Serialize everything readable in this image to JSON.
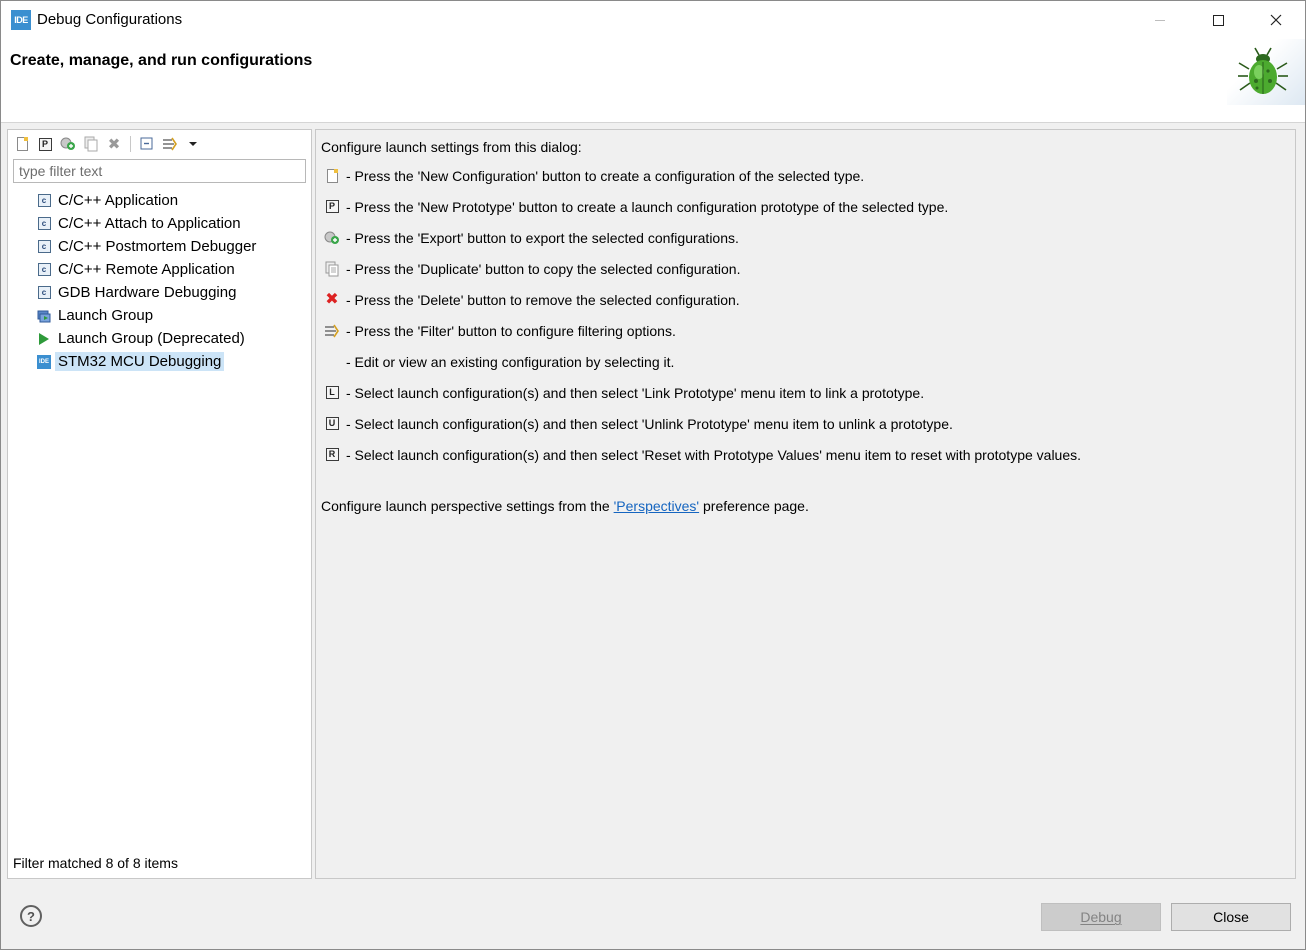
{
  "window": {
    "app_icon_text": "IDE",
    "title": "Debug Configurations"
  },
  "banner": {
    "title": "Create, manage, and run configurations",
    "icon": "bug-icon"
  },
  "left": {
    "toolbar": [
      {
        "name": "new-configuration-button",
        "icon": "new-page-icon"
      },
      {
        "name": "new-prototype-button",
        "icon": "new-prototype-icon"
      },
      {
        "name": "export-button",
        "icon": "export-icon"
      },
      {
        "name": "duplicate-button",
        "icon": "duplicate-icon"
      },
      {
        "name": "delete-button",
        "icon": "delete-icon"
      },
      {
        "name": "collapse-all-button",
        "icon": "collapse-icon"
      },
      {
        "name": "filter-button",
        "icon": "filter-icon"
      },
      {
        "name": "filter-menu-button",
        "icon": "chevron-down-icon"
      }
    ],
    "filter_placeholder": "type filter text",
    "tree": [
      {
        "label": "C/C++ Application",
        "icon": "c-app-icon"
      },
      {
        "label": "C/C++ Attach to Application",
        "icon": "c-app-icon"
      },
      {
        "label": "C/C++ Postmortem Debugger",
        "icon": "c-app-icon"
      },
      {
        "label": "C/C++ Remote Application",
        "icon": "c-app-icon"
      },
      {
        "label": "GDB Hardware Debugging",
        "icon": "c-app-icon"
      },
      {
        "label": "Launch Group",
        "icon": "launch-group-icon"
      },
      {
        "label": "Launch Group (Deprecated)",
        "icon": "play-icon"
      },
      {
        "label": "STM32 MCU Debugging",
        "icon": "ide-icon",
        "selected": true
      }
    ],
    "filter_status": "Filter matched 8 of 8 items"
  },
  "right": {
    "intro": "Configure launch settings from this dialog:",
    "instructions": [
      {
        "icon": "new-page-icon",
        "text": "- Press the 'New Configuration' button to create a configuration of the selected type."
      },
      {
        "icon": "new-prototype-icon",
        "text": "- Press the 'New Prototype' button to create a launch configuration prototype of the selected type."
      },
      {
        "icon": "export-icon",
        "text": "- Press the 'Export' button to export the selected configurations."
      },
      {
        "icon": "duplicate-icon",
        "text": "- Press the 'Duplicate' button to copy the selected configuration."
      },
      {
        "icon": "delete-icon",
        "text": "- Press the 'Delete' button to remove the selected configuration."
      },
      {
        "icon": "filter-icon",
        "text": "- Press the 'Filter' button to configure filtering options."
      },
      {
        "icon": "",
        "text": "- Edit or view an existing configuration by selecting it."
      },
      {
        "icon": "link-prototype-icon",
        "icon_letter": "L",
        "text": "- Select launch configuration(s) and then select 'Link Prototype' menu item to link a prototype."
      },
      {
        "icon": "unlink-prototype-icon",
        "icon_letter": "U",
        "text": "- Select launch configuration(s) and then select 'Unlink Prototype' menu item to unlink a prototype."
      },
      {
        "icon": "reset-prototype-icon",
        "icon_letter": "R",
        "text": "- Select launch configuration(s) and then select 'Reset with Prototype Values' menu item to reset with prototype values."
      }
    ],
    "perspective_before": "Configure launch perspective settings from the ",
    "perspective_link": "'Perspectives'",
    "perspective_after": " preference page."
  },
  "footer": {
    "help": "?",
    "debug_label": "Debug",
    "close_label": "Close"
  },
  "colors": {
    "selection": "#cce4f7",
    "link": "#1565c0",
    "brand": "#3b8fd0"
  }
}
